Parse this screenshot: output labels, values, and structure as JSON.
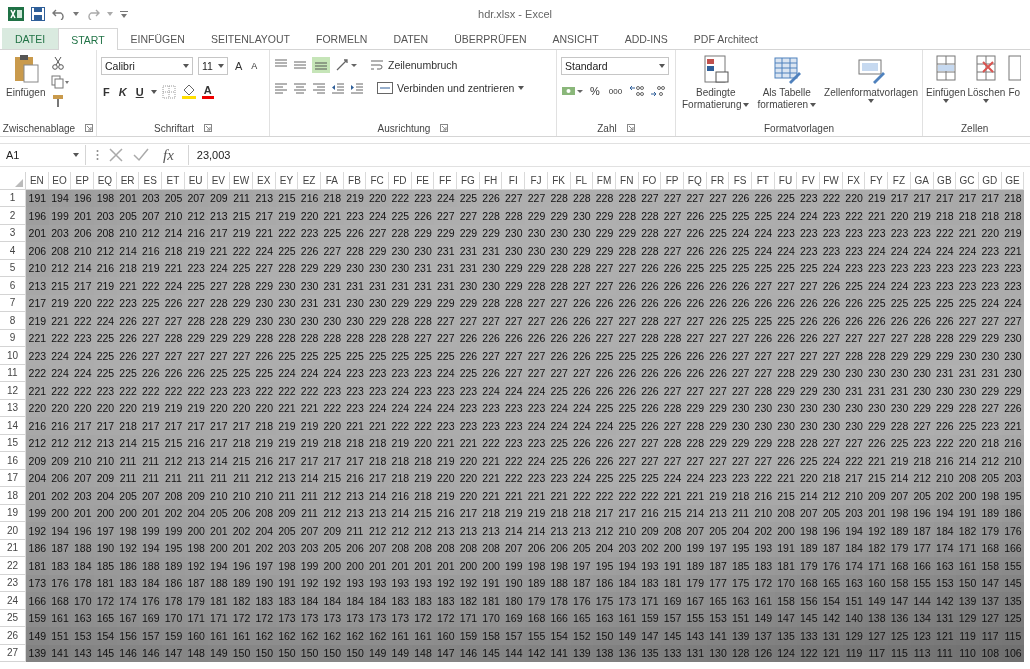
{
  "window": {
    "title": "hdr.xlsx - Excel"
  },
  "tabs": [
    {
      "label": "DATEI",
      "kind": "file",
      "selected": false
    },
    {
      "label": "START",
      "kind": "tab",
      "selected": true
    },
    {
      "label": "EINFÜGEN",
      "kind": "tab",
      "selected": false
    },
    {
      "label": "SEITENLAYOUT",
      "kind": "tab",
      "selected": false
    },
    {
      "label": "FORMELN",
      "kind": "tab",
      "selected": false
    },
    {
      "label": "DATEN",
      "kind": "tab",
      "selected": false
    },
    {
      "label": "ÜBERPRÜFEN",
      "kind": "tab",
      "selected": false
    },
    {
      "label": "ANSICHT",
      "kind": "tab",
      "selected": false
    },
    {
      "label": "ADD-INS",
      "kind": "tab",
      "selected": false
    },
    {
      "label": "PDF Architect",
      "kind": "tab",
      "selected": false
    }
  ],
  "ribbon": {
    "clipboard": {
      "label": "Zwischenablage",
      "paste": "Einfügen"
    },
    "font": {
      "label": "Schriftart",
      "family": "Calibri",
      "size": "11",
      "grow": "A",
      "shrink": "A",
      "bold": "F",
      "italic": "K",
      "underline": "U",
      "font_color": "A"
    },
    "alignment": {
      "label": "Ausrichtung",
      "wrap": "Zeilenumbruch",
      "merge": "Verbinden und zentrieren"
    },
    "number": {
      "label": "Zahl",
      "format": "Standard",
      "percent": "%",
      "thousands": "000"
    },
    "styles": {
      "label": "Formatvorlagen",
      "conditional": [
        "Bedingte",
        "Formatierung"
      ],
      "table": [
        "Als Tabelle",
        "formatieren"
      ],
      "cell": "Zellenformatvorlagen"
    },
    "cells": {
      "label": "Zellen",
      "insert": "Einfügen",
      "delete": "Löschen",
      "format": "Fo"
    }
  },
  "formula_bar": {
    "name_box": "A1",
    "fx": "fx",
    "value": "23,003"
  },
  "sheet": {
    "columns": [
      "EN",
      "EO",
      "EP",
      "EQ",
      "ER",
      "ES",
      "ET",
      "EU",
      "EV",
      "EW",
      "EX",
      "EY",
      "EZ",
      "FA",
      "FB",
      "FC",
      "FD",
      "FE",
      "FF",
      "FG",
      "FH",
      "FI",
      "FJ",
      "FK",
      "FL",
      "FM",
      "FN",
      "FO",
      "FP",
      "FQ",
      "FR",
      "FS",
      "FT",
      "FU",
      "FV",
      "FW",
      "FX",
      "FY",
      "FZ",
      "GA",
      "GB",
      "GC",
      "GD",
      "GE"
    ],
    "rows": [
      {
        "header": "1",
        "cells": [
          "191",
          "194",
          "196",
          "198",
          "201",
          "203",
          "205",
          "207",
          "209",
          "211",
          "213",
          "215",
          "216",
          "218",
          "219",
          "220",
          "222",
          "223",
          "224",
          "225",
          "226",
          "227",
          "227",
          "228",
          "228",
          "228",
          "228",
          "227",
          "227",
          "227",
          "227",
          "226",
          "226",
          "225",
          "223",
          "222",
          "220",
          "219",
          "217",
          "217",
          "217",
          "217",
          "217",
          "218"
        ]
      },
      {
        "header": "2",
        "cells": [
          "196",
          "199",
          "201",
          "203",
          "205",
          "207",
          "210",
          "212",
          "213",
          "215",
          "217",
          "219",
          "220",
          "221",
          "223",
          "224",
          "225",
          "226",
          "227",
          "227",
          "228",
          "228",
          "229",
          "229",
          "230",
          "229",
          "228",
          "228",
          "227",
          "226",
          "225",
          "225",
          "225",
          "224",
          "224",
          "223",
          "222",
          "221",
          "220",
          "219",
          "218",
          "218",
          "218",
          "218"
        ]
      },
      {
        "header": "3",
        "cells": [
          "201",
          "203",
          "206",
          "208",
          "210",
          "212",
          "214",
          "216",
          "217",
          "219",
          "221",
          "222",
          "223",
          "225",
          "226",
          "227",
          "228",
          "229",
          "229",
          "229",
          "229",
          "230",
          "230",
          "230",
          "230",
          "229",
          "229",
          "228",
          "227",
          "226",
          "225",
          "224",
          "224",
          "223",
          "223",
          "223",
          "223",
          "223",
          "223",
          "223",
          "222",
          "221",
          "220",
          "219"
        ]
      },
      {
        "header": "4",
        "cells": [
          "206",
          "208",
          "210",
          "212",
          "214",
          "216",
          "218",
          "219",
          "221",
          "222",
          "224",
          "225",
          "226",
          "227",
          "228",
          "229",
          "230",
          "230",
          "231",
          "231",
          "231",
          "230",
          "230",
          "230",
          "229",
          "229",
          "228",
          "228",
          "227",
          "226",
          "226",
          "225",
          "224",
          "224",
          "223",
          "223",
          "223",
          "224",
          "224",
          "224",
          "224",
          "224",
          "223",
          "221"
        ]
      },
      {
        "header": "5",
        "cells": [
          "210",
          "212",
          "214",
          "216",
          "218",
          "219",
          "221",
          "223",
          "224",
          "225",
          "227",
          "228",
          "229",
          "229",
          "230",
          "230",
          "230",
          "231",
          "231",
          "231",
          "230",
          "229",
          "229",
          "228",
          "228",
          "227",
          "227",
          "226",
          "226",
          "225",
          "225",
          "225",
          "225",
          "225",
          "225",
          "224",
          "223",
          "223",
          "223",
          "223",
          "223",
          "223",
          "223",
          "223"
        ]
      },
      {
        "header": "6",
        "cells": [
          "213",
          "215",
          "217",
          "219",
          "221",
          "222",
          "224",
          "225",
          "227",
          "228",
          "229",
          "230",
          "230",
          "231",
          "231",
          "231",
          "231",
          "231",
          "231",
          "230",
          "230",
          "229",
          "228",
          "228",
          "227",
          "227",
          "226",
          "226",
          "226",
          "226",
          "226",
          "226",
          "227",
          "227",
          "227",
          "226",
          "225",
          "224",
          "224",
          "223",
          "223",
          "223",
          "223",
          "223"
        ]
      },
      {
        "header": "7",
        "cells": [
          "217",
          "219",
          "220",
          "222",
          "223",
          "225",
          "226",
          "227",
          "228",
          "229",
          "230",
          "230",
          "231",
          "231",
          "230",
          "230",
          "229",
          "229",
          "229",
          "229",
          "228",
          "228",
          "227",
          "227",
          "226",
          "226",
          "226",
          "226",
          "226",
          "226",
          "226",
          "226",
          "226",
          "226",
          "226",
          "226",
          "226",
          "225",
          "225",
          "225",
          "225",
          "225",
          "224",
          "224"
        ]
      },
      {
        "header": "8",
        "cells": [
          "219",
          "221",
          "222",
          "224",
          "226",
          "227",
          "227",
          "228",
          "228",
          "229",
          "230",
          "230",
          "230",
          "230",
          "230",
          "229",
          "228",
          "228",
          "227",
          "227",
          "227",
          "227",
          "227",
          "226",
          "226",
          "227",
          "227",
          "228",
          "227",
          "227",
          "226",
          "225",
          "225",
          "225",
          "226",
          "226",
          "226",
          "226",
          "226",
          "226",
          "226",
          "227",
          "227",
          "227"
        ]
      },
      {
        "header": "9",
        "cells": [
          "221",
          "222",
          "223",
          "225",
          "226",
          "227",
          "228",
          "229",
          "229",
          "229",
          "228",
          "228",
          "228",
          "228",
          "228",
          "228",
          "228",
          "227",
          "227",
          "226",
          "226",
          "226",
          "226",
          "226",
          "226",
          "227",
          "227",
          "228",
          "228",
          "227",
          "227",
          "227",
          "226",
          "226",
          "226",
          "227",
          "227",
          "227",
          "227",
          "228",
          "228",
          "229",
          "229",
          "230"
        ]
      },
      {
        "header": "10",
        "cells": [
          "223",
          "224",
          "224",
          "225",
          "226",
          "227",
          "227",
          "227",
          "227",
          "227",
          "226",
          "225",
          "225",
          "225",
          "225",
          "225",
          "225",
          "225",
          "225",
          "226",
          "227",
          "227",
          "227",
          "226",
          "226",
          "225",
          "225",
          "225",
          "226",
          "226",
          "226",
          "227",
          "227",
          "227",
          "227",
          "227",
          "228",
          "228",
          "229",
          "229",
          "229",
          "230",
          "230",
          "230"
        ]
      },
      {
        "header": "11",
        "cells": [
          "222",
          "224",
          "224",
          "225",
          "225",
          "226",
          "226",
          "226",
          "225",
          "225",
          "225",
          "224",
          "224",
          "224",
          "223",
          "223",
          "223",
          "223",
          "224",
          "225",
          "226",
          "227",
          "227",
          "227",
          "227",
          "226",
          "226",
          "226",
          "226",
          "226",
          "226",
          "227",
          "227",
          "228",
          "229",
          "230",
          "230",
          "230",
          "230",
          "230",
          "231",
          "231",
          "231",
          "230"
        ]
      },
      {
        "header": "12",
        "cells": [
          "221",
          "222",
          "222",
          "223",
          "222",
          "222",
          "222",
          "222",
          "223",
          "223",
          "222",
          "222",
          "222",
          "223",
          "223",
          "223",
          "224",
          "223",
          "223",
          "223",
          "224",
          "224",
          "224",
          "225",
          "226",
          "226",
          "226",
          "226",
          "227",
          "227",
          "227",
          "227",
          "228",
          "229",
          "229",
          "230",
          "231",
          "231",
          "231",
          "230",
          "230",
          "230",
          "229",
          "229"
        ]
      },
      {
        "header": "13",
        "cells": [
          "220",
          "220",
          "220",
          "220",
          "220",
          "219",
          "219",
          "219",
          "220",
          "220",
          "220",
          "221",
          "221",
          "222",
          "223",
          "224",
          "224",
          "224",
          "224",
          "223",
          "223",
          "223",
          "223",
          "224",
          "224",
          "225",
          "225",
          "226",
          "228",
          "229",
          "229",
          "230",
          "230",
          "230",
          "230",
          "230",
          "230",
          "230",
          "230",
          "229",
          "229",
          "228",
          "227",
          "226"
        ]
      },
      {
        "header": "14",
        "cells": [
          "216",
          "216",
          "217",
          "217",
          "218",
          "217",
          "217",
          "217",
          "217",
          "217",
          "218",
          "219",
          "219",
          "220",
          "221",
          "221",
          "222",
          "222",
          "223",
          "223",
          "223",
          "223",
          "224",
          "224",
          "224",
          "224",
          "225",
          "226",
          "227",
          "228",
          "229",
          "230",
          "230",
          "230",
          "230",
          "230",
          "230",
          "229",
          "228",
          "227",
          "226",
          "225",
          "223",
          "221"
        ]
      },
      {
        "header": "15",
        "cells": [
          "212",
          "212",
          "212",
          "213",
          "214",
          "215",
          "215",
          "216",
          "217",
          "218",
          "219",
          "219",
          "219",
          "218",
          "218",
          "218",
          "219",
          "220",
          "221",
          "221",
          "222",
          "223",
          "223",
          "225",
          "226",
          "226",
          "227",
          "227",
          "228",
          "228",
          "229",
          "229",
          "229",
          "228",
          "228",
          "227",
          "227",
          "226",
          "225",
          "223",
          "222",
          "220",
          "218",
          "216"
        ]
      },
      {
        "header": "16",
        "cells": [
          "209",
          "209",
          "210",
          "210",
          "211",
          "211",
          "212",
          "213",
          "214",
          "215",
          "216",
          "217",
          "217",
          "217",
          "217",
          "218",
          "218",
          "218",
          "219",
          "220",
          "221",
          "222",
          "224",
          "225",
          "226",
          "226",
          "227",
          "227",
          "227",
          "227",
          "227",
          "227",
          "227",
          "226",
          "225",
          "224",
          "222",
          "221",
          "219",
          "218",
          "216",
          "214",
          "212",
          "210"
        ]
      },
      {
        "header": "17",
        "cells": [
          "204",
          "206",
          "207",
          "209",
          "211",
          "211",
          "211",
          "211",
          "211",
          "211",
          "212",
          "213",
          "214",
          "215",
          "216",
          "217",
          "218",
          "219",
          "220",
          "220",
          "221",
          "222",
          "223",
          "223",
          "224",
          "225",
          "225",
          "225",
          "224",
          "224",
          "223",
          "223",
          "222",
          "221",
          "220",
          "218",
          "217",
          "215",
          "214",
          "212",
          "210",
          "208",
          "205",
          "203"
        ]
      },
      {
        "header": "18",
        "cells": [
          "201",
          "202",
          "203",
          "204",
          "205",
          "207",
          "208",
          "209",
          "210",
          "210",
          "210",
          "211",
          "211",
          "212",
          "213",
          "214",
          "216",
          "218",
          "219",
          "220",
          "221",
          "221",
          "221",
          "221",
          "222",
          "222",
          "222",
          "222",
          "221",
          "221",
          "219",
          "218",
          "216",
          "215",
          "214",
          "212",
          "210",
          "209",
          "207",
          "205",
          "202",
          "200",
          "198",
          "195"
        ]
      },
      {
        "header": "19",
        "cells": [
          "199",
          "200",
          "201",
          "200",
          "200",
          "201",
          "202",
          "204",
          "205",
          "206",
          "208",
          "209",
          "211",
          "212",
          "213",
          "213",
          "214",
          "215",
          "216",
          "217",
          "218",
          "219",
          "219",
          "218",
          "218",
          "217",
          "217",
          "216",
          "215",
          "214",
          "213",
          "211",
          "210",
          "208",
          "207",
          "205",
          "203",
          "201",
          "198",
          "196",
          "194",
          "191",
          "189",
          "186"
        ]
      },
      {
        "header": "20",
        "cells": [
          "192",
          "194",
          "196",
          "197",
          "198",
          "199",
          "199",
          "200",
          "201",
          "202",
          "204",
          "205",
          "207",
          "209",
          "211",
          "212",
          "212",
          "212",
          "213",
          "213",
          "213",
          "214",
          "214",
          "213",
          "213",
          "212",
          "210",
          "209",
          "208",
          "207",
          "205",
          "204",
          "202",
          "200",
          "198",
          "196",
          "194",
          "192",
          "189",
          "187",
          "184",
          "182",
          "179",
          "176"
        ]
      },
      {
        "header": "21",
        "cells": [
          "186",
          "187",
          "188",
          "190",
          "192",
          "194",
          "195",
          "198",
          "200",
          "201",
          "202",
          "203",
          "203",
          "205",
          "206",
          "207",
          "208",
          "208",
          "208",
          "208",
          "208",
          "207",
          "206",
          "206",
          "205",
          "204",
          "203",
          "202",
          "200",
          "199",
          "197",
          "195",
          "193",
          "191",
          "189",
          "187",
          "184",
          "182",
          "179",
          "177",
          "174",
          "171",
          "168",
          "166"
        ]
      },
      {
        "header": "22",
        "cells": [
          "181",
          "183",
          "184",
          "185",
          "186",
          "188",
          "189",
          "192",
          "194",
          "196",
          "197",
          "198",
          "199",
          "200",
          "200",
          "201",
          "201",
          "201",
          "201",
          "200",
          "200",
          "199",
          "198",
          "198",
          "197",
          "195",
          "194",
          "193",
          "191",
          "189",
          "187",
          "185",
          "183",
          "181",
          "179",
          "176",
          "174",
          "171",
          "168",
          "166",
          "163",
          "161",
          "158",
          "155"
        ]
      },
      {
        "header": "23",
        "cells": [
          "173",
          "176",
          "178",
          "181",
          "183",
          "184",
          "186",
          "187",
          "188",
          "189",
          "190",
          "191",
          "192",
          "192",
          "193",
          "193",
          "193",
          "193",
          "192",
          "192",
          "191",
          "190",
          "189",
          "188",
          "187",
          "186",
          "184",
          "183",
          "181",
          "179",
          "177",
          "175",
          "172",
          "170",
          "168",
          "165",
          "163",
          "160",
          "158",
          "155",
          "153",
          "150",
          "147",
          "145"
        ]
      },
      {
        "header": "24",
        "cells": [
          "166",
          "168",
          "170",
          "172",
          "174",
          "176",
          "178",
          "179",
          "181",
          "182",
          "183",
          "183",
          "184",
          "184",
          "184",
          "184",
          "183",
          "183",
          "183",
          "182",
          "181",
          "180",
          "179",
          "178",
          "176",
          "175",
          "173",
          "171",
          "169",
          "167",
          "165",
          "163",
          "161",
          "158",
          "156",
          "154",
          "151",
          "149",
          "147",
          "144",
          "142",
          "139",
          "137",
          "135"
        ]
      },
      {
        "header": "25",
        "cells": [
          "159",
          "161",
          "163",
          "165",
          "167",
          "169",
          "170",
          "171",
          "171",
          "172",
          "172",
          "173",
          "173",
          "173",
          "173",
          "173",
          "173",
          "172",
          "172",
          "171",
          "170",
          "169",
          "168",
          "166",
          "165",
          "163",
          "161",
          "159",
          "157",
          "155",
          "153",
          "151",
          "149",
          "147",
          "145",
          "142",
          "140",
          "138",
          "136",
          "134",
          "131",
          "129",
          "127",
          "125"
        ]
      },
      {
        "header": "26",
        "cells": [
          "149",
          "151",
          "153",
          "154",
          "156",
          "157",
          "159",
          "160",
          "161",
          "161",
          "162",
          "162",
          "162",
          "162",
          "162",
          "162",
          "161",
          "161",
          "160",
          "159",
          "158",
          "157",
          "155",
          "154",
          "152",
          "150",
          "149",
          "147",
          "145",
          "143",
          "141",
          "139",
          "137",
          "135",
          "133",
          "131",
          "129",
          "127",
          "125",
          "123",
          "121",
          "119",
          "117",
          "115"
        ]
      },
      {
        "header": "27",
        "cells": [
          "139",
          "141",
          "143",
          "145",
          "146",
          "146",
          "147",
          "148",
          "149",
          "150",
          "150",
          "150",
          "150",
          "150",
          "150",
          "149",
          "149",
          "148",
          "147",
          "146",
          "145",
          "144",
          "142",
          "141",
          "139",
          "138",
          "136",
          "135",
          "133",
          "131",
          "130",
          "128",
          "126",
          "124",
          "122",
          "121",
          "119",
          "117",
          "115",
          "113",
          "111",
          "110",
          "108",
          "106"
        ]
      }
    ]
  }
}
